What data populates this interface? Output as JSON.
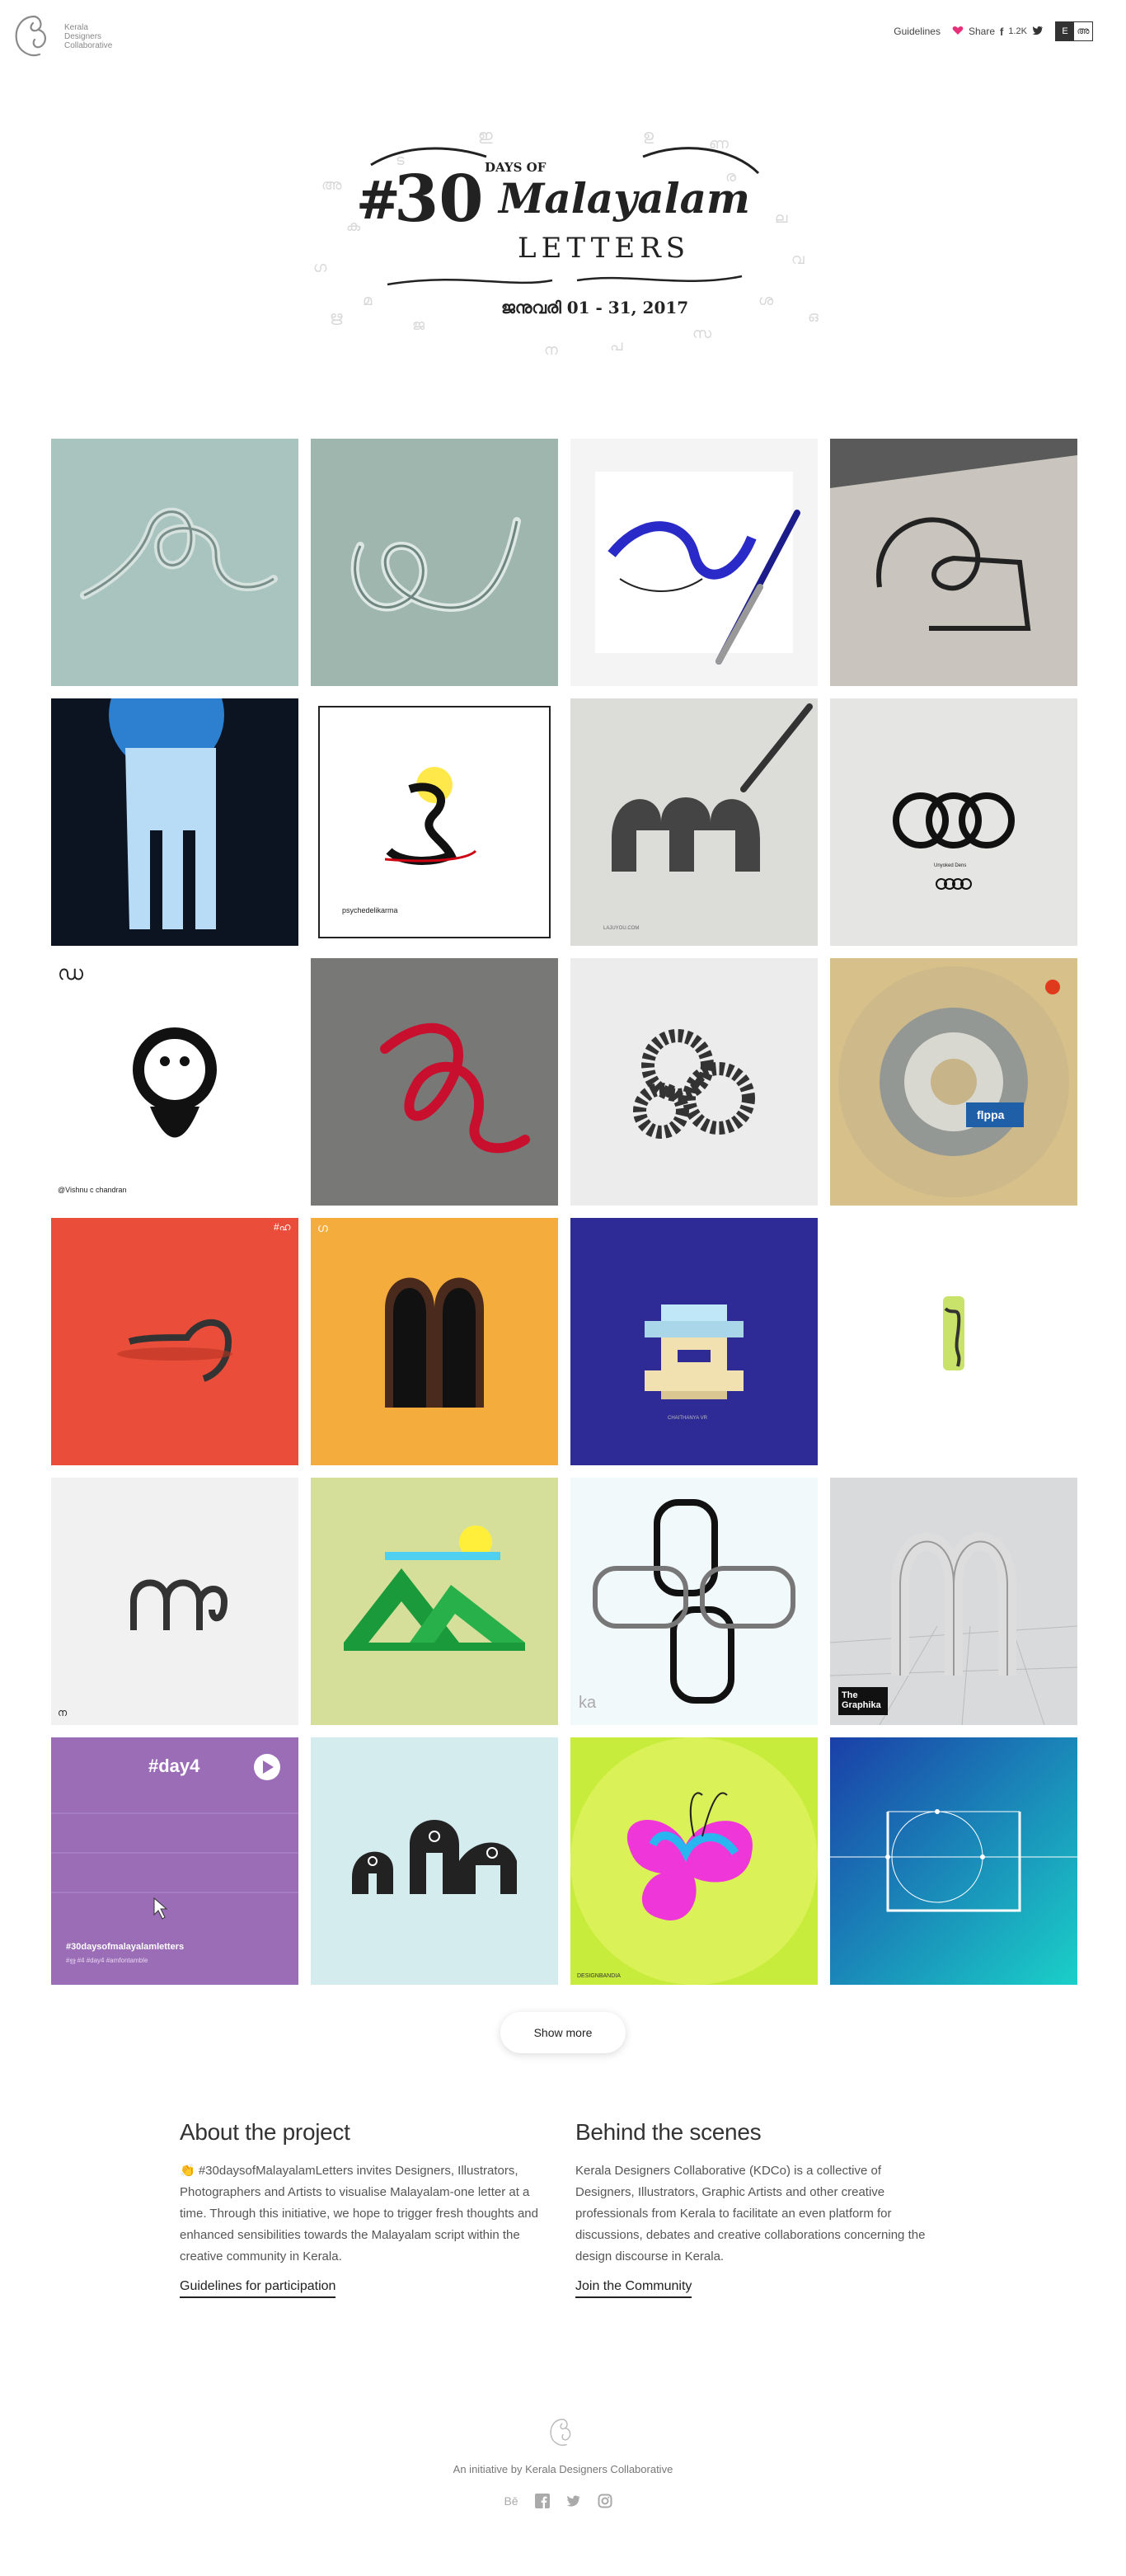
{
  "header": {
    "logo_text": "Kerala Designers Collaborative",
    "nav": {
      "guidelines": "Guidelines",
      "share": "Share",
      "share_count": "1.2K",
      "lang_active": "E",
      "lang_inactive": "അ"
    }
  },
  "hero": {
    "hashtag": "#",
    "number": "30",
    "days_of": "DAYS OF",
    "title": "Malayalam",
    "subtitle": "LETTERS",
    "date": "ജനുവരി 01 - 31, 2017"
  },
  "grid": {
    "tiles": [
      {
        "caption": ""
      },
      {
        "caption": ""
      },
      {
        "caption": ""
      },
      {
        "caption": ""
      },
      {
        "caption": ""
      },
      {
        "caption": "psychedelikarma"
      },
      {
        "caption": "LAJUYOU.COM"
      },
      {
        "caption": "Unyoked Dens"
      },
      {
        "caption": "@Vishnu c chandran",
        "letter": "ഡ"
      },
      {
        "caption": ""
      },
      {
        "caption": ""
      },
      {
        "caption": "flppa"
      },
      {
        "caption": "#ഹ"
      },
      {
        "caption": "ഗ"
      },
      {
        "caption": "CHAITHANYA VR"
      },
      {
        "caption": ""
      },
      {
        "caption": "ന"
      },
      {
        "caption": ""
      },
      {
        "caption": "ka"
      },
      {
        "caption": "The Graphika"
      },
      {
        "caption": "#30daysofmalayalamletters",
        "title": "#day4",
        "tags": "#ഋ  #4  #day4  #amfontamble"
      },
      {
        "caption": ""
      },
      {
        "caption": "DESIGNBANDIA"
      },
      {
        "caption": ""
      }
    ]
  },
  "show_more": "Show more",
  "about": {
    "title": "About the project",
    "body": "👏 #30daysofMalayalamLetters invites Designers, Illustrators, Photographers and Artists to visualise Malayalam-one letter at a time. Through this initiative, we hope to trigger fresh thoughts and enhanced sensibilities towards the Malayalam script within the creative community in Kerala.",
    "cta": "Guidelines for participation"
  },
  "behind": {
    "title": "Behind the scenes",
    "body": "Kerala Designers Collaborative (KDCo) is a collective of Designers, Illustrators, Graphic Artists and other creative professionals from Kerala to facilitate an even platform for discussions, debates and creative collaborations concerning the design discourse in Kerala.",
    "cta": "Join the Community"
  },
  "footer": {
    "tagline": "An initiative by Kerala Designers Collaborative",
    "socials": [
      "Bē",
      "f",
      "t",
      "ig"
    ]
  }
}
